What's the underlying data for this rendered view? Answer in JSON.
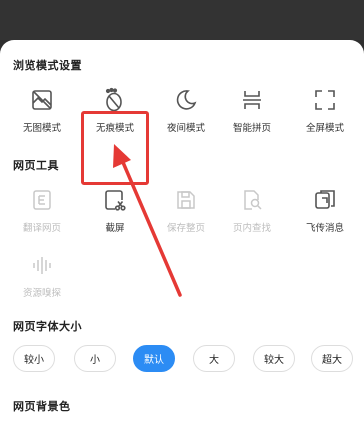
{
  "colors": {
    "accent": "#2c8cf4",
    "highlight": "#e53935",
    "icon": "#555555",
    "icon_disabled": "#c8c8c8"
  },
  "browse_section": {
    "title": "浏览模式设置",
    "items": [
      {
        "label": "无图模式",
        "icon": "no-image-icon"
      },
      {
        "label": "无痕模式",
        "icon": "footprint-icon"
      },
      {
        "label": "夜间模式",
        "icon": "moon-icon"
      },
      {
        "label": "智能拼页",
        "icon": "smart-page-icon"
      },
      {
        "label": "全屏模式",
        "icon": "fullscreen-icon"
      }
    ]
  },
  "tools_section": {
    "title": "网页工具",
    "items": [
      {
        "label": "翻译网页",
        "icon": "translate-icon",
        "enabled": false
      },
      {
        "label": "截屏",
        "icon": "screenshot-icon",
        "enabled": true
      },
      {
        "label": "保存整页",
        "icon": "save-page-icon",
        "enabled": false
      },
      {
        "label": "页内查找",
        "icon": "find-in-page-icon",
        "enabled": false
      },
      {
        "label": "飞传消息",
        "icon": "share-message-icon",
        "enabled": true
      },
      {
        "label": "资源嗅探",
        "icon": "resource-sniff-icon",
        "enabled": false
      }
    ]
  },
  "font_section": {
    "title": "网页字体大小",
    "options": [
      "较小",
      "小",
      "默认",
      "大",
      "较大",
      "超大"
    ],
    "selected": "默认"
  },
  "background_section": {
    "title": "网页背景色"
  }
}
